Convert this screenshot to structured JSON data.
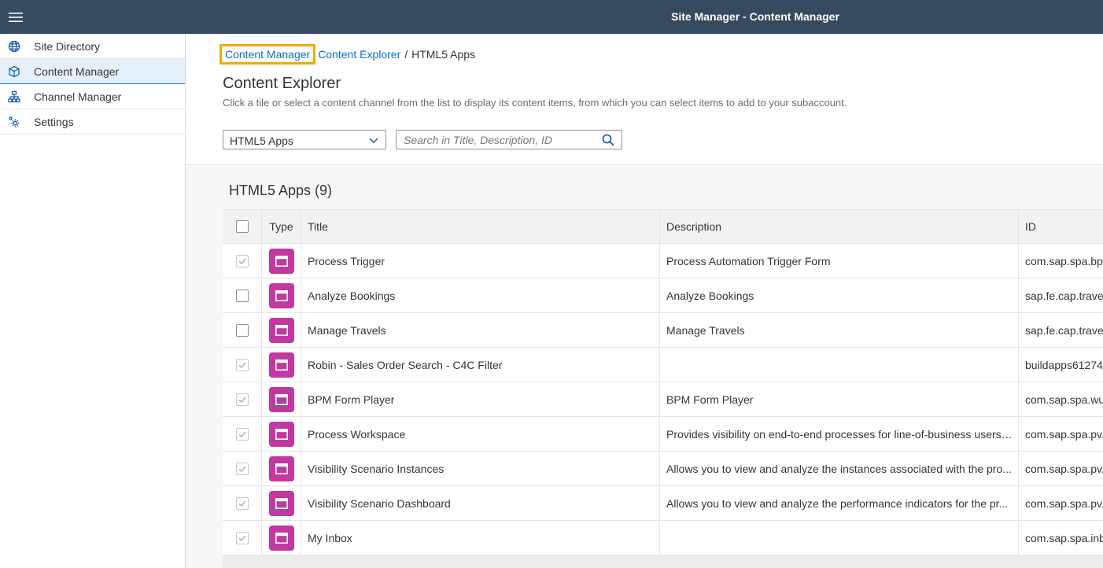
{
  "shell": {
    "title": "Site Manager - Content Manager",
    "menu_icon": "hamburger-menu-icon",
    "background": "#354a5f"
  },
  "sidebar": {
    "items": [
      {
        "label": "Site Directory",
        "icon": "globe-icon",
        "selected": false
      },
      {
        "label": "Content Manager",
        "icon": "cube-icon",
        "selected": true
      },
      {
        "label": "Channel Manager",
        "icon": "hierarchy-icon",
        "selected": false
      },
      {
        "label": "Settings",
        "icon": "gear-icon",
        "selected": false
      }
    ]
  },
  "breadcrumb": {
    "items": [
      "Content Manager",
      "Content Explorer"
    ],
    "separator": "/",
    "current": "HTML5 Apps"
  },
  "page": {
    "title": "Content Explorer",
    "description": "Click a tile or select a content channel from the list to display its content items, from which you can select items to add to your subaccount."
  },
  "filter": {
    "selected": "HTML5 Apps"
  },
  "search": {
    "placeholder": "Search in Title, Description, ID",
    "value": ""
  },
  "table": {
    "title": "HTML5 Apps (9)",
    "headers": {
      "type": "Type",
      "title": "Title",
      "description": "Description",
      "id": "ID"
    },
    "rows": [
      {
        "checked": true,
        "title": "Process Trigger",
        "description": "Process Automation Trigger Form",
        "id": "com.sap.spa.bpi"
      },
      {
        "checked": false,
        "title": "Analyze Bookings",
        "description": "Analyze Bookings",
        "id": "sap.fe.cap.travel"
      },
      {
        "checked": false,
        "title": "Manage Travels",
        "description": "Manage Travels",
        "id": "sap.fe.cap.travel"
      },
      {
        "checked": true,
        "title": "Robin - Sales Order Search - C4C Filter",
        "description": "",
        "id": "buildapps61274"
      },
      {
        "checked": true,
        "title": "BPM Form Player",
        "description": "BPM Form Player",
        "id": "com.sap.spa.wu"
      },
      {
        "checked": true,
        "title": "Process Workspace",
        "description": "Provides visibility on end-to-end processes for line-of-business users ...",
        "id": "com.sap.spa.pv."
      },
      {
        "checked": true,
        "title": "Visibility Scenario Instances",
        "description": "Allows you to view and analyze the instances associated with the pro...",
        "id": "com.sap.spa.pv."
      },
      {
        "checked": true,
        "title": "Visibility Scenario Dashboard",
        "description": "Allows you to view and analyze the performance indicators for the pr...",
        "id": "com.sap.spa.pv."
      },
      {
        "checked": true,
        "title": "My Inbox",
        "description": "",
        "id": "com.sap.spa.inb"
      }
    ]
  },
  "colors": {
    "link": "#0a6ed1",
    "focus_outline": "#f0ab00",
    "app_icon": "#c0399f",
    "selected_nav": "#e5f0fa"
  }
}
